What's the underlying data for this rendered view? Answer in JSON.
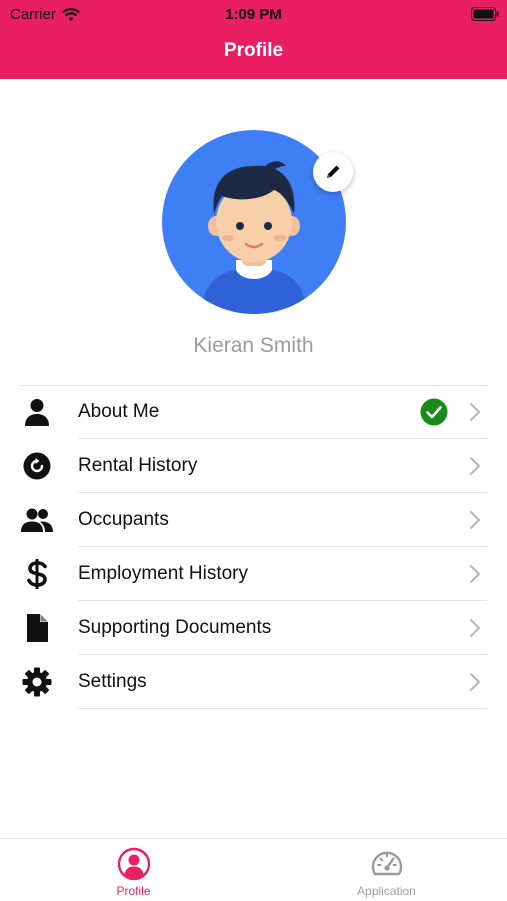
{
  "status_bar": {
    "carrier": "Carrier",
    "time": "1:09 PM"
  },
  "header": {
    "title": "Profile"
  },
  "profile": {
    "name": "Kieran Smith"
  },
  "menu": {
    "items": [
      {
        "label": "About Me",
        "icon": "person-icon",
        "completed": true
      },
      {
        "label": "Rental History",
        "icon": "history-icon"
      },
      {
        "label": "Occupants",
        "icon": "people-icon"
      },
      {
        "label": "Employment History",
        "icon": "dollar-icon"
      },
      {
        "label": "Supporting Documents",
        "icon": "document-icon"
      },
      {
        "label": "Settings",
        "icon": "gear-icon"
      }
    ]
  },
  "tab_bar": {
    "tabs": [
      {
        "label": "Profile",
        "icon": "profile-icon",
        "active": true
      },
      {
        "label": "Application",
        "icon": "speedometer-icon",
        "active": false
      }
    ]
  },
  "colors": {
    "accent": "#e91e63",
    "avatar_bg": "#3f7ff5",
    "check": "#1a8a1a"
  }
}
